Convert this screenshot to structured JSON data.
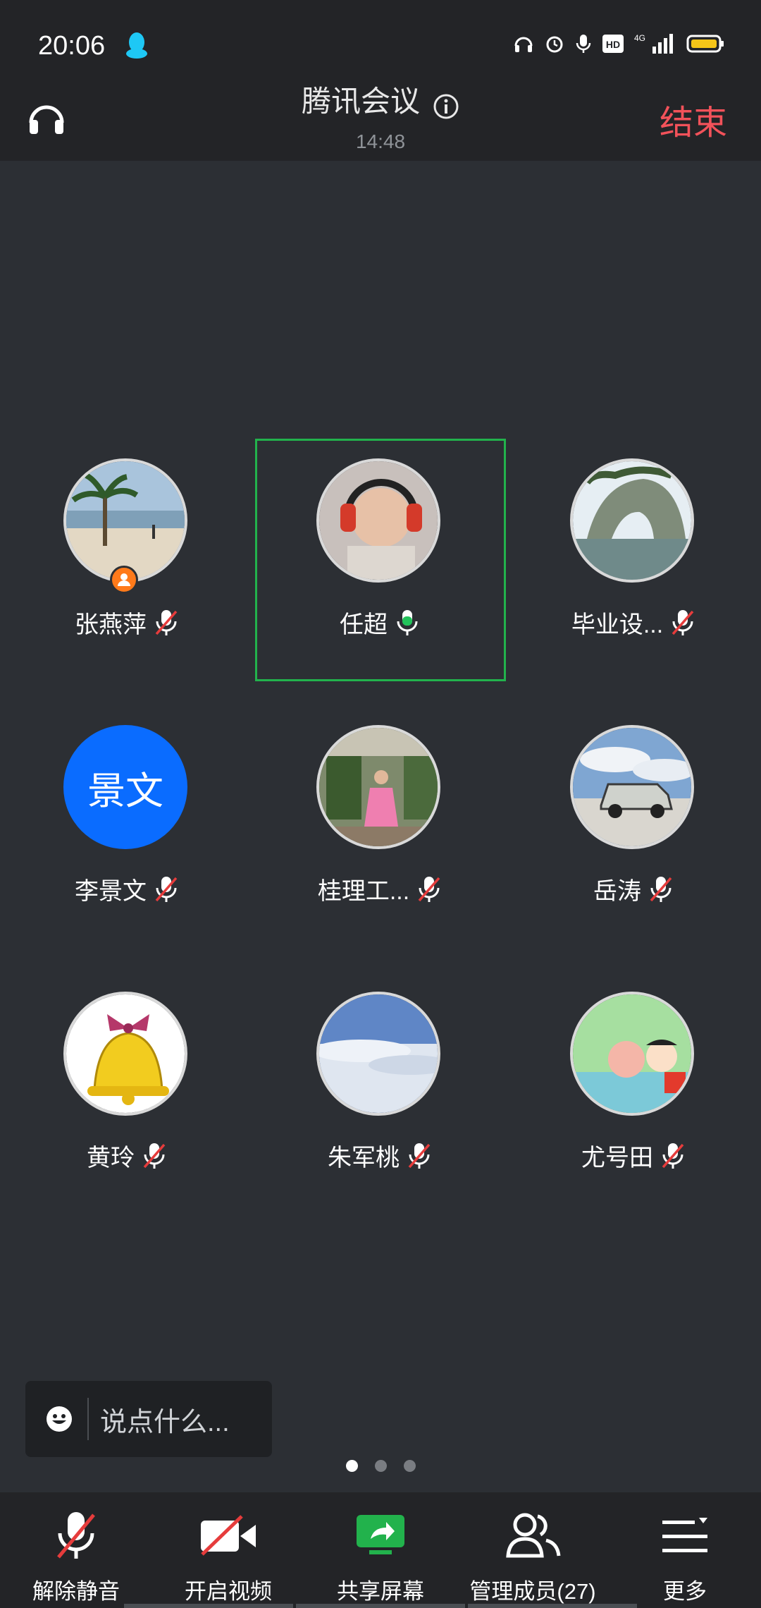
{
  "status": {
    "time": "20:06"
  },
  "header": {
    "title": "腾讯会议",
    "duration": "14:48",
    "end_label": "结束"
  },
  "participants": [
    {
      "name": "张燕萍",
      "muted": true,
      "host": true,
      "avatar": "beach-photo"
    },
    {
      "name": "任超",
      "muted": false,
      "speaking": true,
      "avatar": "child-headphones-photo"
    },
    {
      "name": "毕业设...",
      "muted": true,
      "avatar": "elephant-rock-photo"
    },
    {
      "name": "李景文",
      "muted": true,
      "avatar_text": "景文"
    },
    {
      "name": "桂理工...",
      "muted": true,
      "avatar": "girl-pink-dress-photo"
    },
    {
      "name": "岳涛",
      "muted": true,
      "avatar": "suv-photo"
    },
    {
      "name": "黄玲",
      "muted": true,
      "avatar": "bell-image"
    },
    {
      "name": "朱军桃",
      "muted": true,
      "avatar": "sky-photo"
    },
    {
      "name": "尤号田",
      "muted": true,
      "avatar": "cartoon-kids-image"
    }
  ],
  "chat": {
    "placeholder": "说点什么..."
  },
  "pager": {
    "pages": 3,
    "current": 1
  },
  "toolbar": {
    "unmute": "解除静音",
    "video": "开启视频",
    "share": "共享屏幕",
    "members": "管理成员(27)",
    "more": "更多"
  },
  "colors": {
    "accent_green": "#22b24c",
    "end_red": "#f2525a",
    "avatar_blue": "#0a6cff",
    "host_orange": "#ff7a1a"
  }
}
